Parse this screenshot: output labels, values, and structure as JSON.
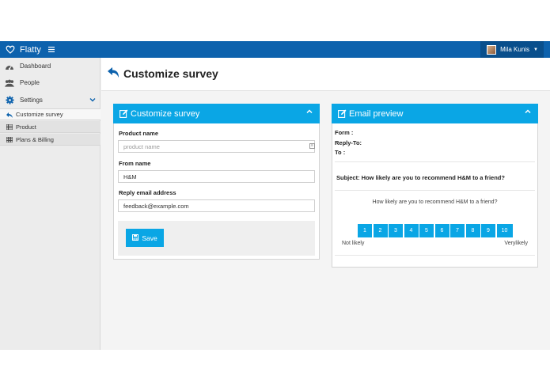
{
  "app": {
    "name": "Flatty",
    "user_name": "Mila Kunis"
  },
  "sidebar": {
    "items": [
      {
        "label": "Dashboard",
        "icon": "dashboard-icon"
      },
      {
        "label": "People",
        "icon": "people-icon"
      },
      {
        "label": "Settings",
        "icon": "gear-icon"
      }
    ],
    "subitems": [
      {
        "label": "Customize survey",
        "icon": "reply-icon"
      },
      {
        "label": "Product",
        "icon": "list-icon"
      },
      {
        "label": "Plans & Billing",
        "icon": "table-icon"
      }
    ]
  },
  "page": {
    "title": "Customize survey"
  },
  "form": {
    "title": "Customize survey",
    "product_label": "Product name",
    "product_placeholder": "product name",
    "product_value": "",
    "from_label": "From name",
    "from_value": "H&M",
    "reply_label": "Reply email address",
    "reply_value": "feedback@example.com",
    "save_label": "Save"
  },
  "preview": {
    "title": "Email preview",
    "form_label": "Form :",
    "reply_to_label": "Reply-To:",
    "to_label": "To :",
    "subject": "Subject: How likely are you to recommend H&M to a friend?",
    "question": "How likely are you to recommend H&M to a friend?",
    "scale": [
      "1",
      "2",
      "3",
      "4",
      "5",
      "6",
      "7",
      "8",
      "9",
      "10"
    ],
    "low_label": "Not likely",
    "high_label": "Verylikely"
  },
  "colors": {
    "topbar": "#0d62ad",
    "accent": "#0aa6e5",
    "sidebar": "#ececec"
  }
}
